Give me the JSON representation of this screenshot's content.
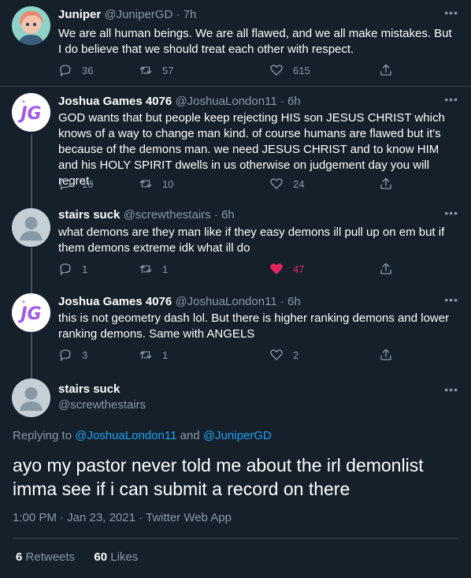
{
  "colors": {
    "background": "#15202b",
    "secondary_text": "#8899a6",
    "link": "#1da1f2",
    "like": "#e0245e",
    "divider": "#38444d"
  },
  "tweets": [
    {
      "name": "Juniper",
      "handle": "@JuniperGD",
      "time": "7h",
      "text": "We are all human beings. We are all flawed, and we all make mistakes. But I do believe that we should treat each other with respect.",
      "replies": "36",
      "retweets": "57",
      "likes": "615",
      "liked": false
    },
    {
      "name": "Joshua Games 4076",
      "handle": "@JoshuaLondon11",
      "time": "6h",
      "text": "GOD wants that but people keep rejecting HIS son JESUS CHRIST which knows of a way to change man kind. of course humans are flawed but it's because of the demons man. we need JESUS CHRIST and to know HIM and his HOLY SPIRIT dwells in us otherwise on judgement day you will regret.",
      "replies": "10",
      "retweets": "10",
      "likes": "24",
      "liked": false
    },
    {
      "name": "stairs suck",
      "handle": "@screwthestairs",
      "time": "6h",
      "text": "what demons are they man like if they easy demons ill pull up on em but if them demons extreme idk what ill do",
      "replies": "1",
      "retweets": "1",
      "likes": "47",
      "liked": true
    },
    {
      "name": "Joshua Games 4076",
      "handle": "@JoshuaLondon11",
      "time": "6h",
      "text": "this is not geometry dash lol. But there is higher ranking demons and lower ranking demons. Same with ANGELS",
      "replies": "3",
      "retweets": "1",
      "likes": "2",
      "liked": false
    }
  ],
  "main": {
    "name": "stairs suck",
    "handle": "@screwthestairs",
    "replying_prefix": "Replying to",
    "replying_to_1": "@JoshuaLondon11",
    "replying_and": "and",
    "replying_to_2": "@JuniperGD",
    "text": "ayo my pastor never told me about the irl demonlist imma see if i can submit a record on there",
    "timestamp": "1:00 PM · Jan 23, 2021 · Twitter Web App",
    "retweets_count": "6",
    "retweets_label": "Retweets",
    "likes_count": "60",
    "likes_label": "Likes"
  },
  "icons": {
    "more": "more-icon",
    "reply": "reply-icon",
    "retweet": "retweet-icon",
    "like": "heart-icon",
    "share": "share-icon"
  }
}
